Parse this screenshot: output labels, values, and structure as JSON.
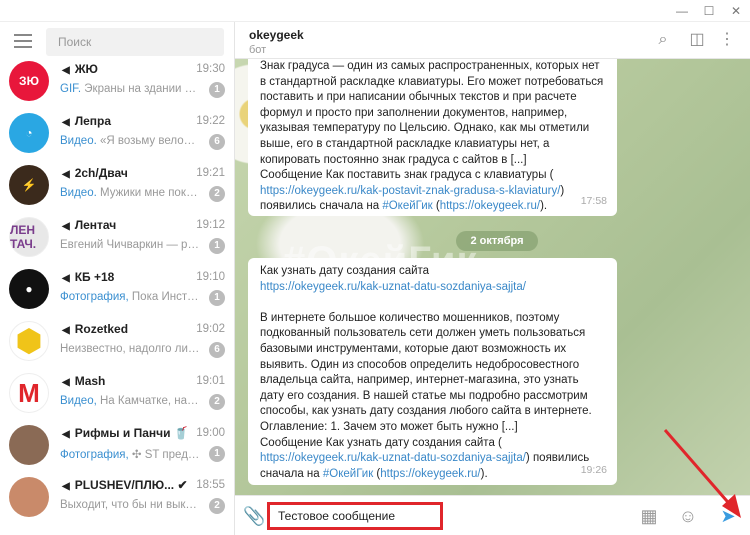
{
  "window": {
    "minimize": "—",
    "maximize": "☐",
    "close": "✕"
  },
  "sidebar": {
    "search_placeholder": "Поиск",
    "chats": [
      {
        "name": "ЖЮ",
        "time": "19:30",
        "kind": "GIF.",
        "preview": " Экраны на здании со...",
        "unread": "1",
        "avatar_color": "#e8173b",
        "avatar_text": "ЗЮ"
      },
      {
        "name": "Лепра",
        "time": "19:22",
        "kind": "Видео.",
        "preview": " «Я возьму велосип...",
        "unread": "6",
        "avatar_color": "#2aa7e3",
        "avatar_text": "◔"
      },
      {
        "name": "2ch/Двач",
        "time": "19:21",
        "kind": "Видео.",
        "preview": " Мужики мне пока...",
        "unread": "2",
        "avatar_color": "#3b2a1c",
        "avatar_text": "⚡"
      },
      {
        "name": "Лентач",
        "time": "19:12",
        "kind": "",
        "preview": "Евгений Чичваркин — ро...",
        "unread": "1",
        "avatar_color": "#e8e8e8",
        "avatar_text": "ЛЕН ТАЧ."
      },
      {
        "name": "КБ +18",
        "time": "19:10",
        "kind": "Фотография,",
        "preview": " Пока Инстас...",
        "unread": "1",
        "avatar_color": "#111",
        "avatar_text": "●"
      },
      {
        "name": "Rozetked",
        "time": "19:02",
        "kind": "",
        "preview": "Неизвестно, надолго ли, ...",
        "unread": "6",
        "avatar_color": "#fff",
        "avatar_text": "⬢"
      },
      {
        "name": "Mash",
        "time": "19:01",
        "kind": "Видео,",
        "preview": " На Камчатке, на п...",
        "unread": "2",
        "avatar_color": "#fff",
        "avatar_text": "M"
      },
      {
        "name": "Рифмы и Панчи 🥤",
        "time": "19:00",
        "kind": "Фотография,",
        "preview": " ✣ ST предс...",
        "unread": "1",
        "avatar_color": "#8a6a55",
        "avatar_text": ""
      },
      {
        "name": "PLUSHEV/ПЛЮ... ✔",
        "time": "18:55",
        "kind": "",
        "preview": "Выходит, что бы ни выки...",
        "unread": "2",
        "avatar_color": "#c98a6a",
        "avatar_text": ""
      }
    ]
  },
  "chat": {
    "name": "okeygeek",
    "status": "бот",
    "date_divider": "2 октября",
    "watermark": "#ОкейГик",
    "msg1": {
      "text": "Знак градуса — один из самых распространенных, которых нет в стандартной раскладке клавиатуры. Его может потребоваться поставить и при написании обычных текстов и при расчете формул и просто при заполнении документов, например, указывая температуру по Цельсию. Однако, как мы отметили выше, его в стандартной раскладке клавиатуры нет, а копировать постоянно знак градуса с сайтов в [...]",
      "src_prefix": "Сообщение Как поставить знак градуса с клавиатуры (",
      "link": "https://okeygeek.ru/kak-postavit-znak-gradusa-s-klaviatury/",
      "mid": ") появились сначала на ",
      "tag": "#ОкейГик",
      "site": "https://okeygeek.ru/",
      "end": ").",
      "time": "17:58"
    },
    "msg2": {
      "title": "Как узнать дату создания сайта",
      "title_link": "https://okeygeek.ru/kak-uznat-datu-sozdaniya-sajjta/",
      "text": "В интернете большое количество мошенников, поэтому подкованный пользователь сети должен уметь пользоваться базовыми инструментами, которые дают возможность их выявить. Один из способов определить недобросовестного владельца сайта, например, интернет-магазина, это узнать дату его создания. В нашей статье мы подробно рассмотрим способы, как узнать дату создания любого сайта в интернете. Оглавление: 1. Зачем это может быть нужно [...]",
      "src_prefix": "Сообщение Как узнать дату создания сайта (",
      "link": "https://okeygeek.ru/kak-uznat-datu-sozdaniya-sajjta/",
      "mid": ") появились сначала на ",
      "tag": "#ОкейГик",
      "site": "https://okeygeek.ru/",
      "end": ").",
      "time": "19:26"
    }
  },
  "composer": {
    "value": "Тестовое сообщение"
  },
  "colors": {
    "accent": "#3a88c8",
    "highlight": "#e0262b"
  }
}
